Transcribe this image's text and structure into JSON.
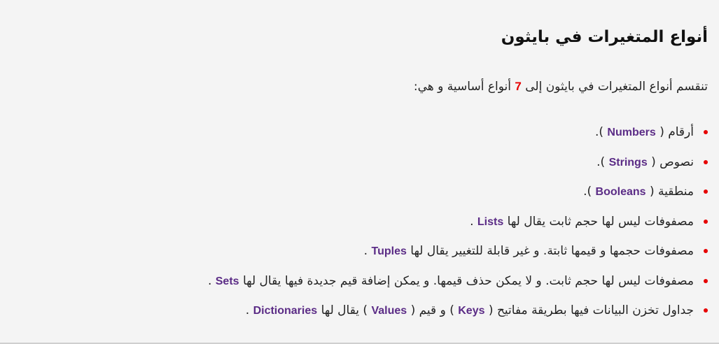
{
  "title": "أنواع المتغيرات في بايثون",
  "intro": {
    "before": "تنقسم أنواع المتغيرات في بايثون إلى",
    "number": "7",
    "after": "أنواع أساسية و هي:"
  },
  "items": [
    {
      "before": "أرقام (",
      "term1": "Numbers",
      "middle": ").",
      "term2": "",
      "after": ""
    },
    {
      "before": "نصوص (",
      "term1": "Strings",
      "middle": ").",
      "term2": "",
      "after": ""
    },
    {
      "before": "منطقية (",
      "term1": "Booleans",
      "middle": ").",
      "term2": "",
      "after": ""
    },
    {
      "before": "مصفوفات ليس لها حجم ثابت يقال لها",
      "term1": "Lists",
      "middle": ".",
      "term2": "",
      "after": ""
    },
    {
      "before": "مصفوفات حجمها و قيمها ثابتة. و غير قابلة للتغيير يقال لها",
      "term1": "Tuples",
      "middle": ".",
      "term2": "",
      "after": ""
    },
    {
      "before": "مصفوفات ليس لها حجم ثابت. و لا يمكن حذف قيمها. و يمكن إضافة قيم جديدة فيها يقال لها",
      "term1": "Sets",
      "middle": ".",
      "term2": "",
      "after": ""
    },
    {
      "before": "جداول تخزن البيانات فيها بطريقة مفاتيح (",
      "term1": "Keys",
      "middle": ") و قيم (",
      "term2": "Values",
      "after": ") يقال لها",
      "term3": "Dictionaries",
      "end": "."
    }
  ],
  "colors": {
    "accent": "#e60000",
    "term": "#5b2c86",
    "background": "#f4f4f4"
  }
}
